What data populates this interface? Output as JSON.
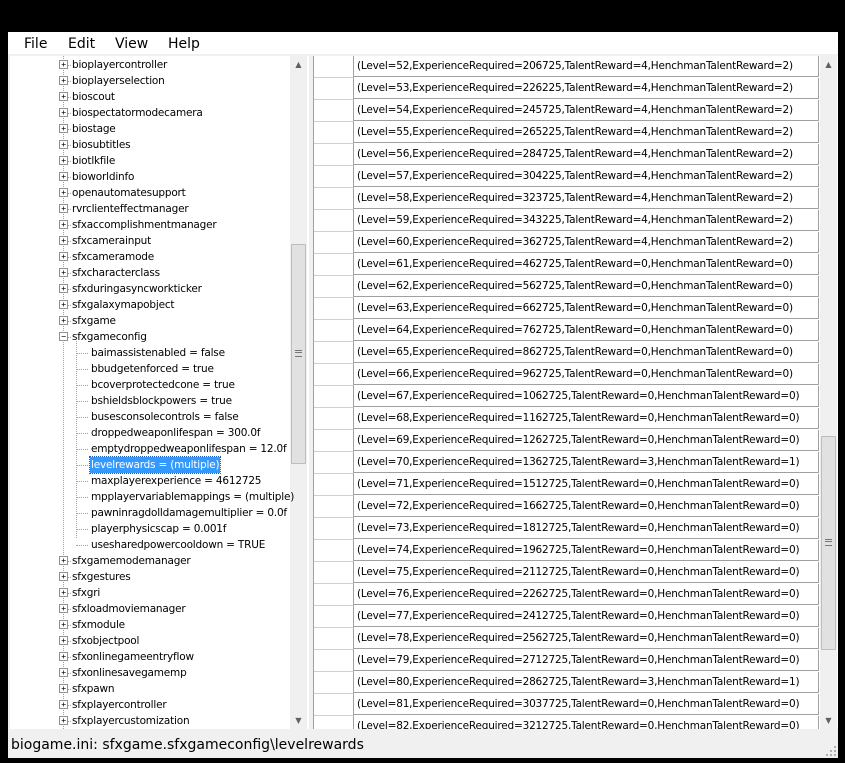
{
  "menu": [
    "File",
    "Edit",
    "View",
    "Help"
  ],
  "tree": {
    "expander_collapsed": "+",
    "expander_expanded": "−",
    "scroll_up": "▲",
    "scroll_down": "▼",
    "nodes_before": [
      "bioplayercontroller",
      "bioplayerselection",
      "bioscout",
      "biospectatormodecamera",
      "biostage",
      "biosubtitles",
      "biotlkfile",
      "bioworldinfo",
      "openautomatesupport",
      "rvrclienteffectmanager",
      "sfxaccomplishmentmanager",
      "sfxcamerainput",
      "sfxcameramode",
      "sfxcharacterclass",
      "sfxduringasyncworkticker",
      "sfxgalaxymapobject",
      "sfxgame"
    ],
    "expanded_node": "sfxgameconfig",
    "children": [
      "baimassistenabled = false",
      "bbudgetenforced = true",
      "bcoverprotectedcone = true",
      "bshieldsblockpowers = true",
      "busesconsolecontrols = false",
      "droppedweaponlifespan = 300.0f",
      "emptydroppedweaponlifespan = 12.0f",
      "levelrewards = (multiple)",
      "maxplayerexperience = 4612725",
      "mpplayervariablemappings = (multiple)",
      "pawninragdolldamagemultiplier = 0.0f",
      "playerphysicscap = 0.001f",
      "usesharedpowercooldown = TRUE"
    ],
    "selected_child_index": 7,
    "nodes_after": [
      "sfxgamemodemanager",
      "sfxgestures",
      "sfxgri",
      "sfxloadmoviemanager",
      "sfxmodule",
      "sfxobjectpool",
      "sfxonlinegameentryflow",
      "sfxonlinesavegamemp",
      "sfxpawn",
      "sfxplayercontroller",
      "sfxplayercustomization"
    ]
  },
  "grid": {
    "scroll_up": "▲",
    "scroll_down": "▼",
    "rows": [
      "(Level=52,ExperienceRequired=206725,TalentReward=4,HenchmanTalentReward=2)",
      "(Level=53,ExperienceRequired=226225,TalentReward=4,HenchmanTalentReward=2)",
      "(Level=54,ExperienceRequired=245725,TalentReward=4,HenchmanTalentReward=2)",
      "(Level=55,ExperienceRequired=265225,TalentReward=4,HenchmanTalentReward=2)",
      "(Level=56,ExperienceRequired=284725,TalentReward=4,HenchmanTalentReward=2)",
      "(Level=57,ExperienceRequired=304225,TalentReward=4,HenchmanTalentReward=2)",
      "(Level=58,ExperienceRequired=323725,TalentReward=4,HenchmanTalentReward=2)",
      "(Level=59,ExperienceRequired=343225,TalentReward=4,HenchmanTalentReward=2)",
      "(Level=60,ExperienceRequired=362725,TalentReward=4,HenchmanTalentReward=2)",
      "(Level=61,ExperienceRequired=462725,TalentReward=0,HenchmanTalentReward=0)",
      "(Level=62,ExperienceRequired=562725,TalentReward=0,HenchmanTalentReward=0)",
      "(Level=63,ExperienceRequired=662725,TalentReward=0,HenchmanTalentReward=0)",
      "(Level=64,ExperienceRequired=762725,TalentReward=0,HenchmanTalentReward=0)",
      "(Level=65,ExperienceRequired=862725,TalentReward=0,HenchmanTalentReward=0)",
      "(Level=66,ExperienceRequired=962725,TalentReward=0,HenchmanTalentReward=0)",
      "(Level=67,ExperienceRequired=1062725,TalentReward=0,HenchmanTalentReward=0)",
      "(Level=68,ExperienceRequired=1162725,TalentReward=0,HenchmanTalentReward=0)",
      "(Level=69,ExperienceRequired=1262725,TalentReward=0,HenchmanTalentReward=0)",
      "(Level=70,ExperienceRequired=1362725,TalentReward=3,HenchmanTalentReward=1)",
      "(Level=71,ExperienceRequired=1512725,TalentReward=0,HenchmanTalentReward=0)",
      "(Level=72,ExperienceRequired=1662725,TalentReward=0,HenchmanTalentReward=0)",
      "(Level=73,ExperienceRequired=1812725,TalentReward=0,HenchmanTalentReward=0)",
      "(Level=74,ExperienceRequired=1962725,TalentReward=0,HenchmanTalentReward=0)",
      "(Level=75,ExperienceRequired=2112725,TalentReward=0,HenchmanTalentReward=0)",
      "(Level=76,ExperienceRequired=2262725,TalentReward=0,HenchmanTalentReward=0)",
      "(Level=77,ExperienceRequired=2412725,TalentReward=0,HenchmanTalentReward=0)",
      "(Level=78,ExperienceRequired=2562725,TalentReward=0,HenchmanTalentReward=0)",
      "(Level=79,ExperienceRequired=2712725,TalentReward=0,HenchmanTalentReward=0)",
      "(Level=80,ExperienceRequired=2862725,TalentReward=3,HenchmanTalentReward=1)",
      "(Level=81,ExperienceRequired=3037725,TalentReward=0,HenchmanTalentReward=0)",
      "(Level=82,ExperienceRequired=3212725,TalentReward=0,HenchmanTalentReward=0)"
    ]
  },
  "status": {
    "path": "biogame.ini: sfxgame.sfxgameconfig\\levelrewards"
  }
}
